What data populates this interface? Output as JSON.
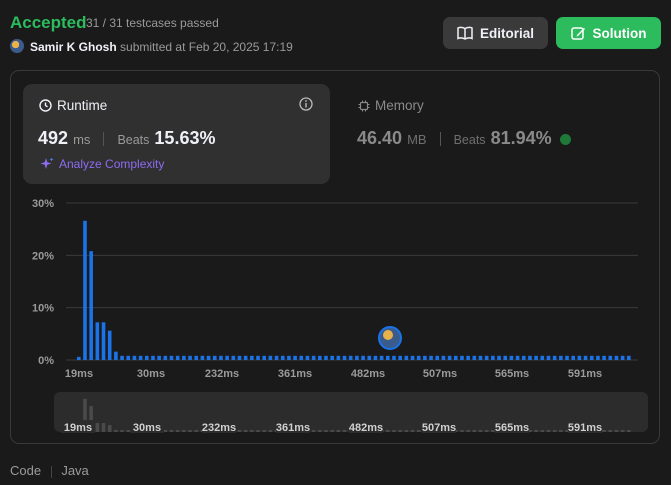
{
  "header": {
    "status": "Accepted",
    "testcases": "31 / 31 testcases passed",
    "username": "Samir K Ghosh",
    "submitted_text": "submitted at Feb 20, 2025 17:19",
    "editorial_label": "Editorial",
    "solution_label": "Solution"
  },
  "runtime": {
    "title": "Runtime",
    "value": "492",
    "unit": "ms",
    "beats_label": "Beats",
    "beats_value": "15.63%",
    "analyze_label": "Analyze Complexity"
  },
  "memory": {
    "title": "Memory",
    "value": "46.40",
    "unit": "MB",
    "beats_label": "Beats",
    "beats_value": "81.94%"
  },
  "chart_data": {
    "type": "bar",
    "ylim": [
      0,
      30
    ],
    "y_ticks": [
      "30%",
      "20%",
      "10%",
      "0%"
    ],
    "x_tick_labels": [
      "19ms",
      "30ms",
      "232ms",
      "361ms",
      "482ms",
      "507ms",
      "565ms",
      "591ms"
    ],
    "values": [
      0.6,
      26.6,
      20.8,
      7.2,
      7.2,
      5.6,
      1.6,
      0.8,
      0.8,
      0.8,
      0.8,
      0.8,
      0.8,
      0.8,
      0.8,
      0.8,
      0.8,
      0.8,
      0.8,
      0.8,
      0.8,
      0.8,
      0.8,
      0.8,
      0.8,
      0.8,
      0.8,
      0.8,
      0.8,
      0.8,
      0.8,
      0.8,
      0.8,
      0.8,
      0.8,
      0.8,
      0.8,
      0.8,
      0.8,
      0.8,
      0.8,
      0.8,
      0.8,
      0.8,
      0.8,
      0.8,
      0.8,
      0.8,
      0.8,
      0.8,
      0.8,
      0.8,
      0.8,
      0.8,
      0.8,
      0.8,
      0.8,
      0.8,
      0.8,
      0.8,
      0.8,
      0.8,
      0.8,
      0.8,
      0.8,
      0.8,
      0.8,
      0.8,
      0.8,
      0.8,
      0.8,
      0.8,
      0.8,
      0.8,
      0.8,
      0.8,
      0.8,
      0.8,
      0.8,
      0.8,
      0.8,
      0.8,
      0.8,
      0.8,
      0.8,
      0.8,
      0.8,
      0.8,
      0.8,
      0.8
    ],
    "highlighted_label": "482ms",
    "bar_color": "#1a73e8",
    "minimap_bar_color": "#4a4a4a",
    "grid": true
  },
  "footer": {
    "code_label": "Code",
    "language": "Java"
  },
  "colors": {
    "accepted": "#2cbb5d",
    "solution_button": "#2cbb5d",
    "editorial_button": "#3a3a3a",
    "analyze": "#8d6cf1",
    "bar": "#1a73e8"
  }
}
